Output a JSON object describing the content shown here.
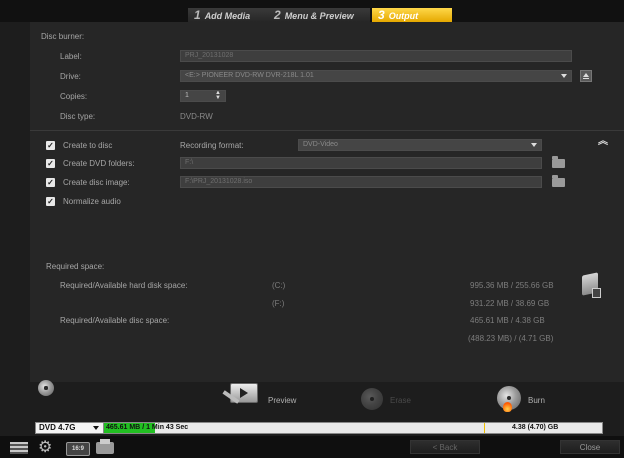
{
  "tabs": [
    {
      "num": "1",
      "label": "Add Media"
    },
    {
      "num": "2",
      "label": "Menu & Preview"
    },
    {
      "num": "3",
      "label": "Output"
    }
  ],
  "disc_burner": {
    "section_label": "Disc burner:",
    "label_label": "Label:",
    "label_value": "PRJ_20131028",
    "drive_label": "Drive:",
    "drive_value": "<E:> PIONEER DVD-RW  DVR-218L 1.01",
    "copies_label": "Copies:",
    "copies_value": "1",
    "disc_type_label": "Disc type:",
    "disc_type_value": "DVD-RW"
  },
  "options": {
    "create_to_disc": "Create to disc",
    "recording_format_label": "Recording format:",
    "recording_format_value": "DVD-Video",
    "create_dvd_folders": "Create DVD folders:",
    "dvd_folders_path": "F:\\",
    "create_disc_image": "Create disc image:",
    "disc_image_path": "F:\\PRJ_20131028.iso",
    "normalize_audio": "Normalize audio"
  },
  "required_space": {
    "section_label": "Required space:",
    "hdd_label": "Required/Available hard disk space:",
    "drive_c": "(C:)",
    "drive_f": "(F:)",
    "c_value": "995.36 MB / 255.66 GB",
    "f_value": "931.22 MB / 38.69 GB",
    "disc_label": "Required/Available disc space:",
    "disc_value": "465.61 MB / 4.38 GB",
    "disc_value2": "(488.23 MB) / (4.71 GB)"
  },
  "actions": {
    "preview": "Preview",
    "erase": "Erase",
    "burn": "Burn"
  },
  "progress": {
    "disc_size": "DVD 4.7G",
    "used_value": "465.61 MB",
    "used_rest": "/ 1 Min 43 Sec",
    "capacity": "4.38 (4.70) GB",
    "fill_fraction": 0.09
  },
  "footer": {
    "back": "< Back",
    "close": "Close"
  },
  "colors": {
    "active_tab": "#f5c400",
    "progress_fill": "#22c022"
  }
}
